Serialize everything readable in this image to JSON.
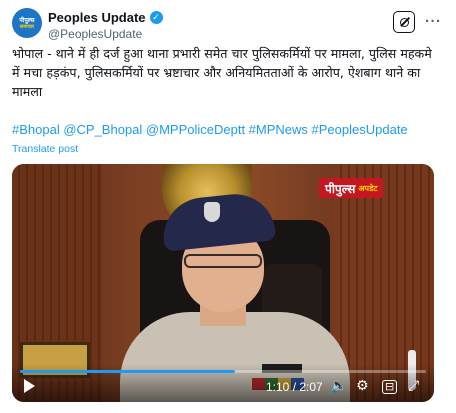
{
  "author": {
    "name": "Peoples Update",
    "handle": "@PeoplesUpdate",
    "avatar_text_top": "पीपुल्स",
    "avatar_text_bottom": "समाचार"
  },
  "post": {
    "text": "भोपाल - थाने में ही दर्ज हुआ थाना प्रभारी समेत चार पुलिसकर्मियों पर मामला, पुलिस महकमे में मचा हड़कंप, पुलिसकर्मियों पर भ्रष्टाचार और अनियमितताओं के आरोप, ऐशबाग थाने का मामला",
    "hashtags": "#Bhopal @CP_Bhopal @MPPoliceDeptt #MPNews #PeoplesUpdate",
    "translate_label": "Translate post"
  },
  "video": {
    "logo_main": "पीपुल्स",
    "logo_sub": "अपडेट",
    "time": "1:10 / 2:07",
    "progress_fraction": 0.53
  },
  "icons": {
    "verified": "verified-badge-icon",
    "grok": "grok-icon",
    "more": "more-icon",
    "play": "play-icon",
    "volume": "volume-icon",
    "settings": "settings-icon",
    "captions": "captions-icon",
    "fullscreen": "fullscreen-icon"
  },
  "colors": {
    "link": "#1d9bf0",
    "verified": "#1d9bf0",
    "logo_bg": "#c4171f"
  }
}
